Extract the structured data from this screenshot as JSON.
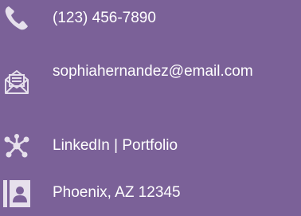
{
  "colors": {
    "background": "#7b6198",
    "icon": "#e6e0ec",
    "text": "#ffffff"
  },
  "contact": {
    "phone": {
      "icon": "phone-icon",
      "text": "(123) 456-7890"
    },
    "email": {
      "icon": "envelope-letter-icon",
      "text": "sophiahernandez@email.com"
    },
    "links": {
      "icon": "network-nodes-icon",
      "text": "LinkedIn | Portfolio"
    },
    "address": {
      "icon": "contact-card-icon",
      "text": "Phoenix, AZ 12345"
    }
  }
}
